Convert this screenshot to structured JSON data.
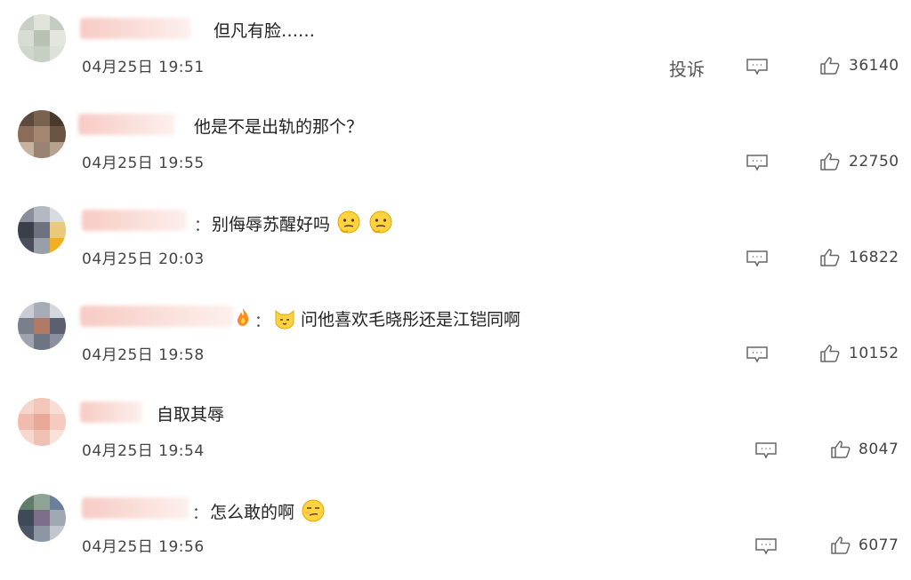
{
  "actions": {
    "report_label": "投诉"
  },
  "comments": [
    {
      "sep": "",
      "text": "但凡有脸……",
      "time": "04月25日 19:51",
      "likes": "36140"
    },
    {
      "sep": "",
      "text": "他是不是出轨的那个？",
      "time": "04月25日 19:55",
      "likes": "22750"
    },
    {
      "sep": "：",
      "text": "别侮辱苏醒好吗",
      "time": "04月25日 20:03",
      "likes": "16822"
    },
    {
      "sep": "：",
      "text": "问他喜欢毛晓彤还是江铠同啊",
      "time": "04月25日 19:58",
      "likes": "10152"
    },
    {
      "sep": "",
      "text": "自取其辱",
      "time": "04月25日 19:54",
      "likes": "8047"
    },
    {
      "sep": "：",
      "text": "怎么敢的啊",
      "time": "04月25日 19:56",
      "likes": "6077"
    }
  ],
  "colors": {
    "name_blur": "#f7cbc4",
    "icon_stroke": "#666666",
    "emoji_yellow": "#ffd23f"
  }
}
